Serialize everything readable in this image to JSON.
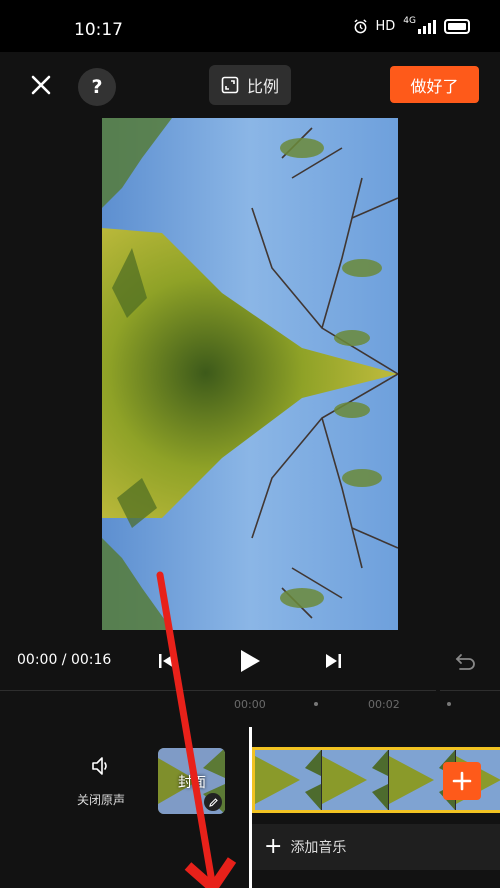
{
  "status_bar": {
    "time": "10:17",
    "hd": "HD",
    "network": "4G"
  },
  "topbar": {
    "help_label": "?",
    "ratio_label": "比例",
    "done_label": "做好了"
  },
  "playback": {
    "timecode": "00:00 / 00:16"
  },
  "timeline": {
    "ruler": [
      "00:00",
      "00:02"
    ],
    "mute_label": "关闭原声",
    "cover_label": "封面",
    "add_music_label": "添加音乐"
  },
  "colors": {
    "accent": "#fe5a1a",
    "clip_border": "#f2c322",
    "annotation": "#e8211a"
  },
  "icons": [
    "close-icon",
    "help-icon",
    "ratio-icon",
    "skip-start-icon",
    "play-icon",
    "skip-end-icon",
    "undo-icon",
    "speaker-icon",
    "edit-icon",
    "plus-icon"
  ]
}
